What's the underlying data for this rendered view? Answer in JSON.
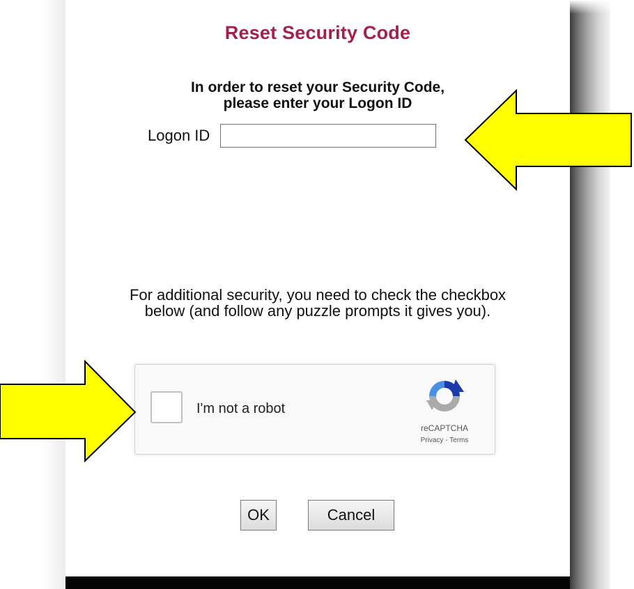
{
  "dialog": {
    "title": "Reset Security Code",
    "instructions_line1": "In order to reset your Security Code,",
    "instructions_line2": "please enter your Logon ID",
    "logon_label": "Logon ID",
    "logon_value": "",
    "security_line1": "For additional security, you need to check the checkbox",
    "security_line2": "below (and follow any puzzle prompts it gives you)."
  },
  "recaptcha": {
    "label": "I'm not a robot",
    "brand": "reCAPTCHA",
    "privacy": "Privacy",
    "separator": " - ",
    "terms": "Terms",
    "checked": false
  },
  "buttons": {
    "ok": "OK",
    "cancel": "Cancel"
  },
  "colors": {
    "title": "#a3224a",
    "arrow_fill": "#ffff00",
    "recaptcha_blue": "#1c3aa9",
    "recaptcha_lightblue": "#4a90e2",
    "recaptcha_gray": "#aaaaaa"
  },
  "icons": {
    "annotation_arrows": [
      "arrow-left-icon",
      "arrow-right-icon"
    ],
    "recaptcha_logo": "recaptcha-logo-icon"
  }
}
